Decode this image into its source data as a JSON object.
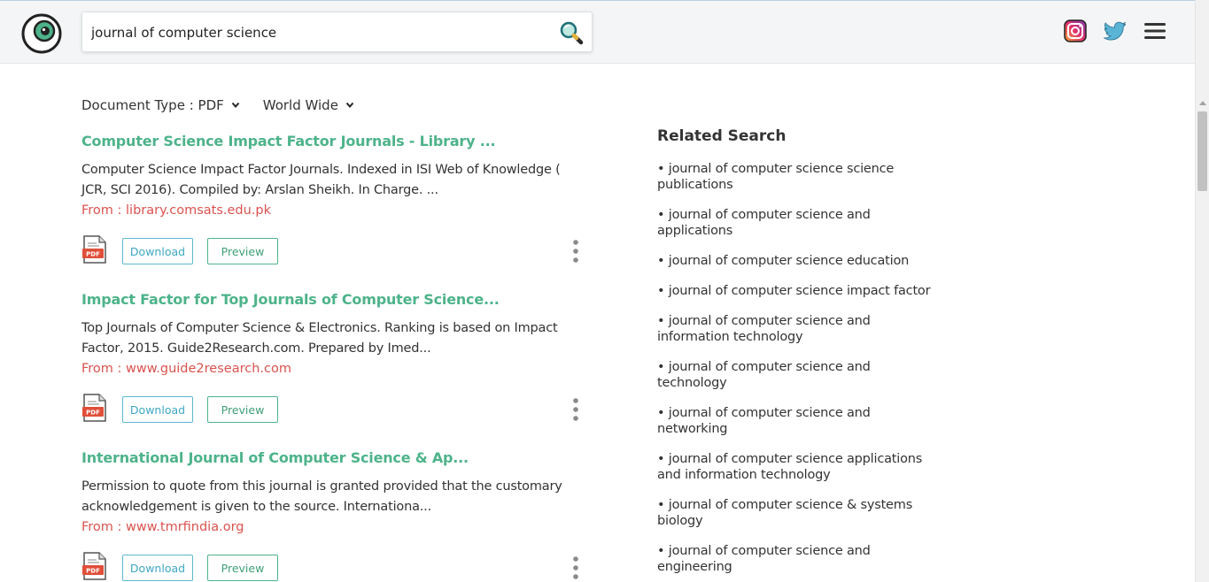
{
  "search": {
    "query": "journal of computer science"
  },
  "filters": {
    "doc_type": "Document Type : PDF",
    "region": "World Wide"
  },
  "results": [
    {
      "title": "Computer Science Impact Factor Journals - Library ...",
      "desc": "Computer Science Impact Factor Journals. Indexed in ISI Web of Knowledge ( JCR, SCI 2016). Compiled by: Arslan Sheikh. In Charge. ...",
      "from": "From : library.comsats.edu.pk",
      "pdf_label": "PDF",
      "download": "Download",
      "preview": "Preview"
    },
    {
      "title": "Impact Factor for Top Journals of Computer Science...",
      "desc": "Top Journals of Computer Science & Electronics. Ranking is based on Impact Factor, 2015. Guide2Research.com. Prepared by Imed...",
      "from": "From : www.guide2research.com",
      "pdf_label": "PDF",
      "download": "Download",
      "preview": "Preview"
    },
    {
      "title": "International Journal of Computer Science & Ap...",
      "desc": "Permission to quote from this journal is granted provided that the customary acknowledgement is given to the source. Internationa...",
      "from": "From : www.tmrfindia.org",
      "pdf_label": "PDF",
      "download": "Download",
      "preview": "Preview"
    }
  ],
  "related": {
    "heading": "Related Search",
    "items": [
      "journal of computer science science publications",
      "journal of computer science and applications",
      "journal of computer science education",
      "journal of computer science impact factor",
      "journal of computer science and information technology",
      "journal of computer science and technology",
      "journal of computer science and networking",
      "journal of computer science applications and information technology",
      "journal of computer science & systems biology",
      "journal of computer science and engineering"
    ]
  },
  "colors": {
    "accent": "#4db38a",
    "source_link": "#d9534f",
    "download_border": "#5bb8cf"
  },
  "icons": [
    "eye-logo-icon",
    "search-magnifier-icon",
    "instagram-icon",
    "twitter-icon",
    "hamburger-menu-icon",
    "chevron-down-icon",
    "pdf-file-icon",
    "more-vertical-icon"
  ]
}
